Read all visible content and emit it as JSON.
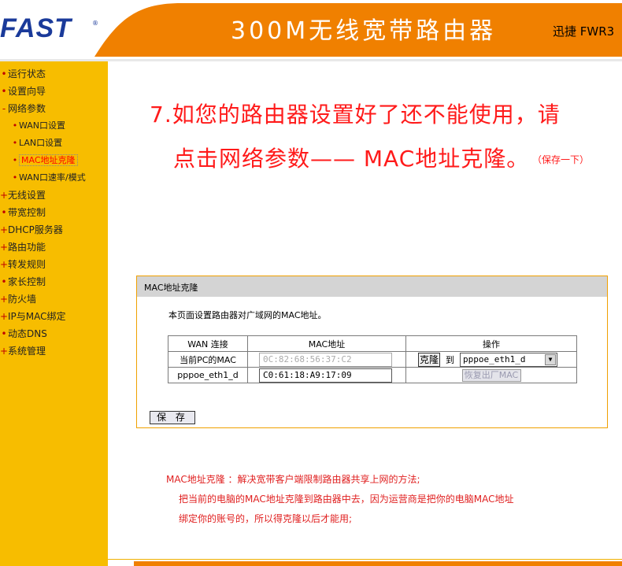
{
  "header": {
    "logo": "FAST",
    "logo_reg": "®",
    "product_title": "300M无线宽带路由器",
    "brand": "迅捷 FWR3",
    "colors": {
      "orange": "#f08000",
      "yellow": "#f7bd00",
      "logo_blue": "#1a3a9a"
    }
  },
  "sidebar": {
    "items": [
      {
        "marker": "•",
        "label": "运行状态"
      },
      {
        "marker": "•",
        "label": "设置向导"
      },
      {
        "marker": "-",
        "label": "网络参数"
      },
      {
        "marker": "•",
        "label": "WAN口设置"
      },
      {
        "marker": "•",
        "label": "LAN口设置"
      },
      {
        "marker": "•",
        "label": "MAC地址克隆"
      },
      {
        "marker": "•",
        "label": "WAN口速率/模式"
      },
      {
        "marker": "+",
        "label": "无线设置"
      },
      {
        "marker": "•",
        "label": "带宽控制"
      },
      {
        "marker": "+",
        "label": "DHCP服务器"
      },
      {
        "marker": "+",
        "label": "路由功能"
      },
      {
        "marker": "+",
        "label": "转发规则"
      },
      {
        "marker": "•",
        "label": "家长控制"
      },
      {
        "marker": "+",
        "label": "防火墙"
      },
      {
        "marker": "+",
        "label": "IP与MAC绑定"
      },
      {
        "marker": "•",
        "label": "动态DNS"
      },
      {
        "marker": "+",
        "label": "系统管理"
      }
    ]
  },
  "tutorial": {
    "line1": "7.如您的路由器设置好了还不能使用，请",
    "line2": "点击网络参数—— MAC地址克隆。",
    "note": "（保存一下）"
  },
  "panel": {
    "title": "MAC地址克隆",
    "description": "本页面设置路由器对广域网的MAC地址。",
    "table": {
      "headers": [
        "WAN 连接",
        "MAC地址",
        "操作"
      ],
      "row1": {
        "label": "当前PC的MAC",
        "mac": "0C:82:68:56:37:C2",
        "clone_button": "克隆",
        "to_label": "到",
        "select_value": "pppoe_eth1_d"
      },
      "row2": {
        "label": "pppoe_eth1_d",
        "mac": "C0:61:18:A9:17:09",
        "restore_button": "恢复出厂MAC"
      }
    },
    "save_button": "保 存"
  },
  "notes": {
    "line1": "MAC地址克隆 ：解决宽带客户端限制路由器共享上网的方法;",
    "line2": "把当前的电脑的MAC地址克隆到路由器中去，因为运营商是把你的电脑MAC地址",
    "line3": "绑定你的账号的，所以得克隆以后才能用;"
  }
}
